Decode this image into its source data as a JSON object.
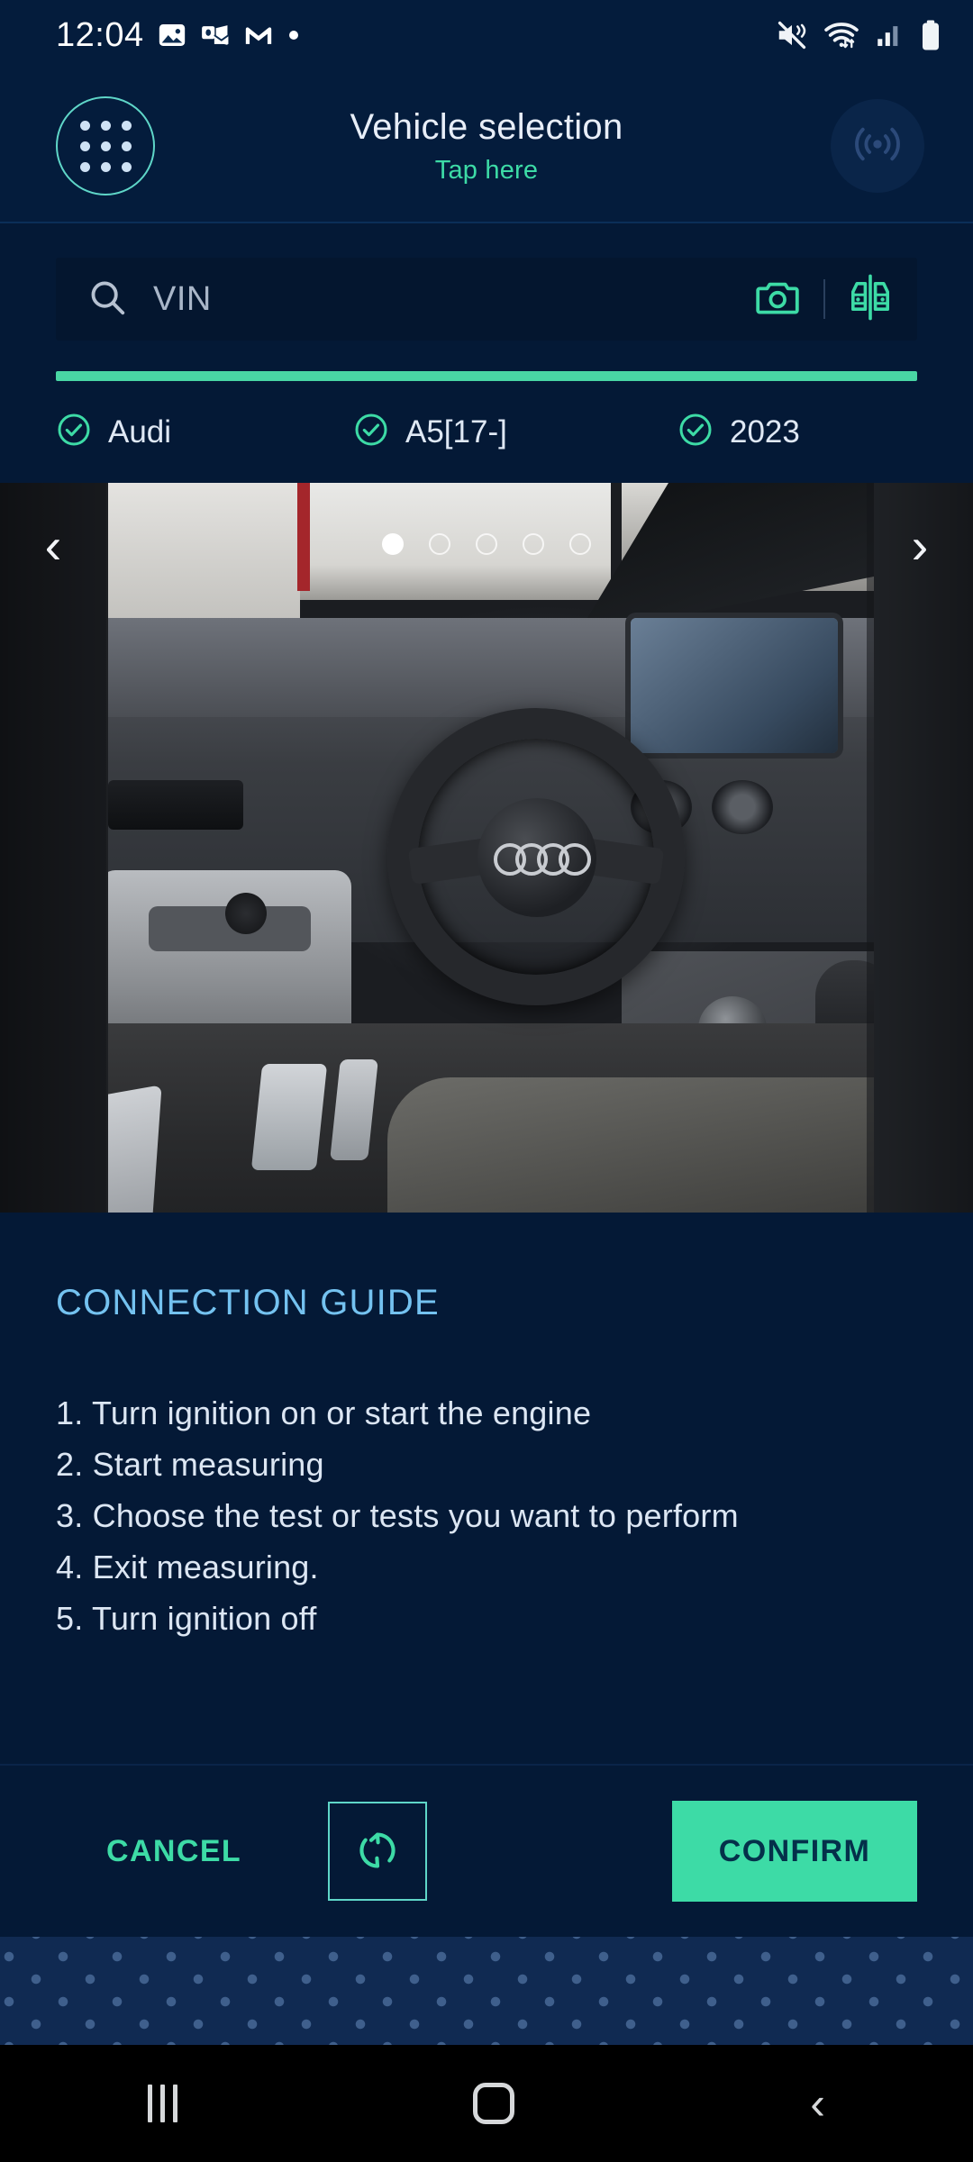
{
  "statusbar": {
    "time": "12:04",
    "left_icons": [
      "photos-icon",
      "outlook-icon",
      "gmail-icon",
      "dot-indicator"
    ],
    "right_icons": [
      "mute-vibrate-icon",
      "wifi-icon",
      "cellular-signal-icon",
      "battery-icon"
    ]
  },
  "header": {
    "title": "Vehicle selection",
    "subtitle": "Tap here",
    "menu_icon": "grid-menu-icon",
    "connection_icon": "wireless-signal-icon"
  },
  "search": {
    "placeholder": "VIN",
    "value": "",
    "search_icon": "search-icon",
    "camera_icon": "camera-icon",
    "compare_icon": "vehicle-compare-icon"
  },
  "progress": {
    "percent": 100
  },
  "selection": [
    {
      "label": "Audi",
      "checked": true
    },
    {
      "label": "A5[17-]",
      "checked": true
    },
    {
      "label": "2023",
      "checked": true
    }
  ],
  "carousel": {
    "total": 5,
    "current": 1,
    "prev_label": "‹",
    "next_label": "›",
    "alt": "Audi A5 interior dashboard and steering wheel"
  },
  "guide": {
    "title": "CONNECTION GUIDE",
    "steps": [
      "1. Turn ignition on or start the engine",
      "2. Start measuring",
      "3. Choose the test or tests you want to perform",
      "4. Exit measuring.",
      "5. Turn ignition off"
    ]
  },
  "actions": {
    "cancel_label": "CANCEL",
    "refresh_icon": "refresh-icon",
    "confirm_label": "CONFIRM"
  },
  "androidnav": {
    "recents_icon": "recents-icon",
    "home_icon": "home-icon",
    "back_icon": "back-icon",
    "back_glyph": "‹"
  },
  "colors": {
    "background": "#041936",
    "header_bg": "#041c3c",
    "accent_green": "#3ddba6",
    "accent_teal": "#5fd6c8",
    "guide_title": "#74c2f0",
    "text_primary": "#dce6f3",
    "dot_band": "#102a52"
  }
}
